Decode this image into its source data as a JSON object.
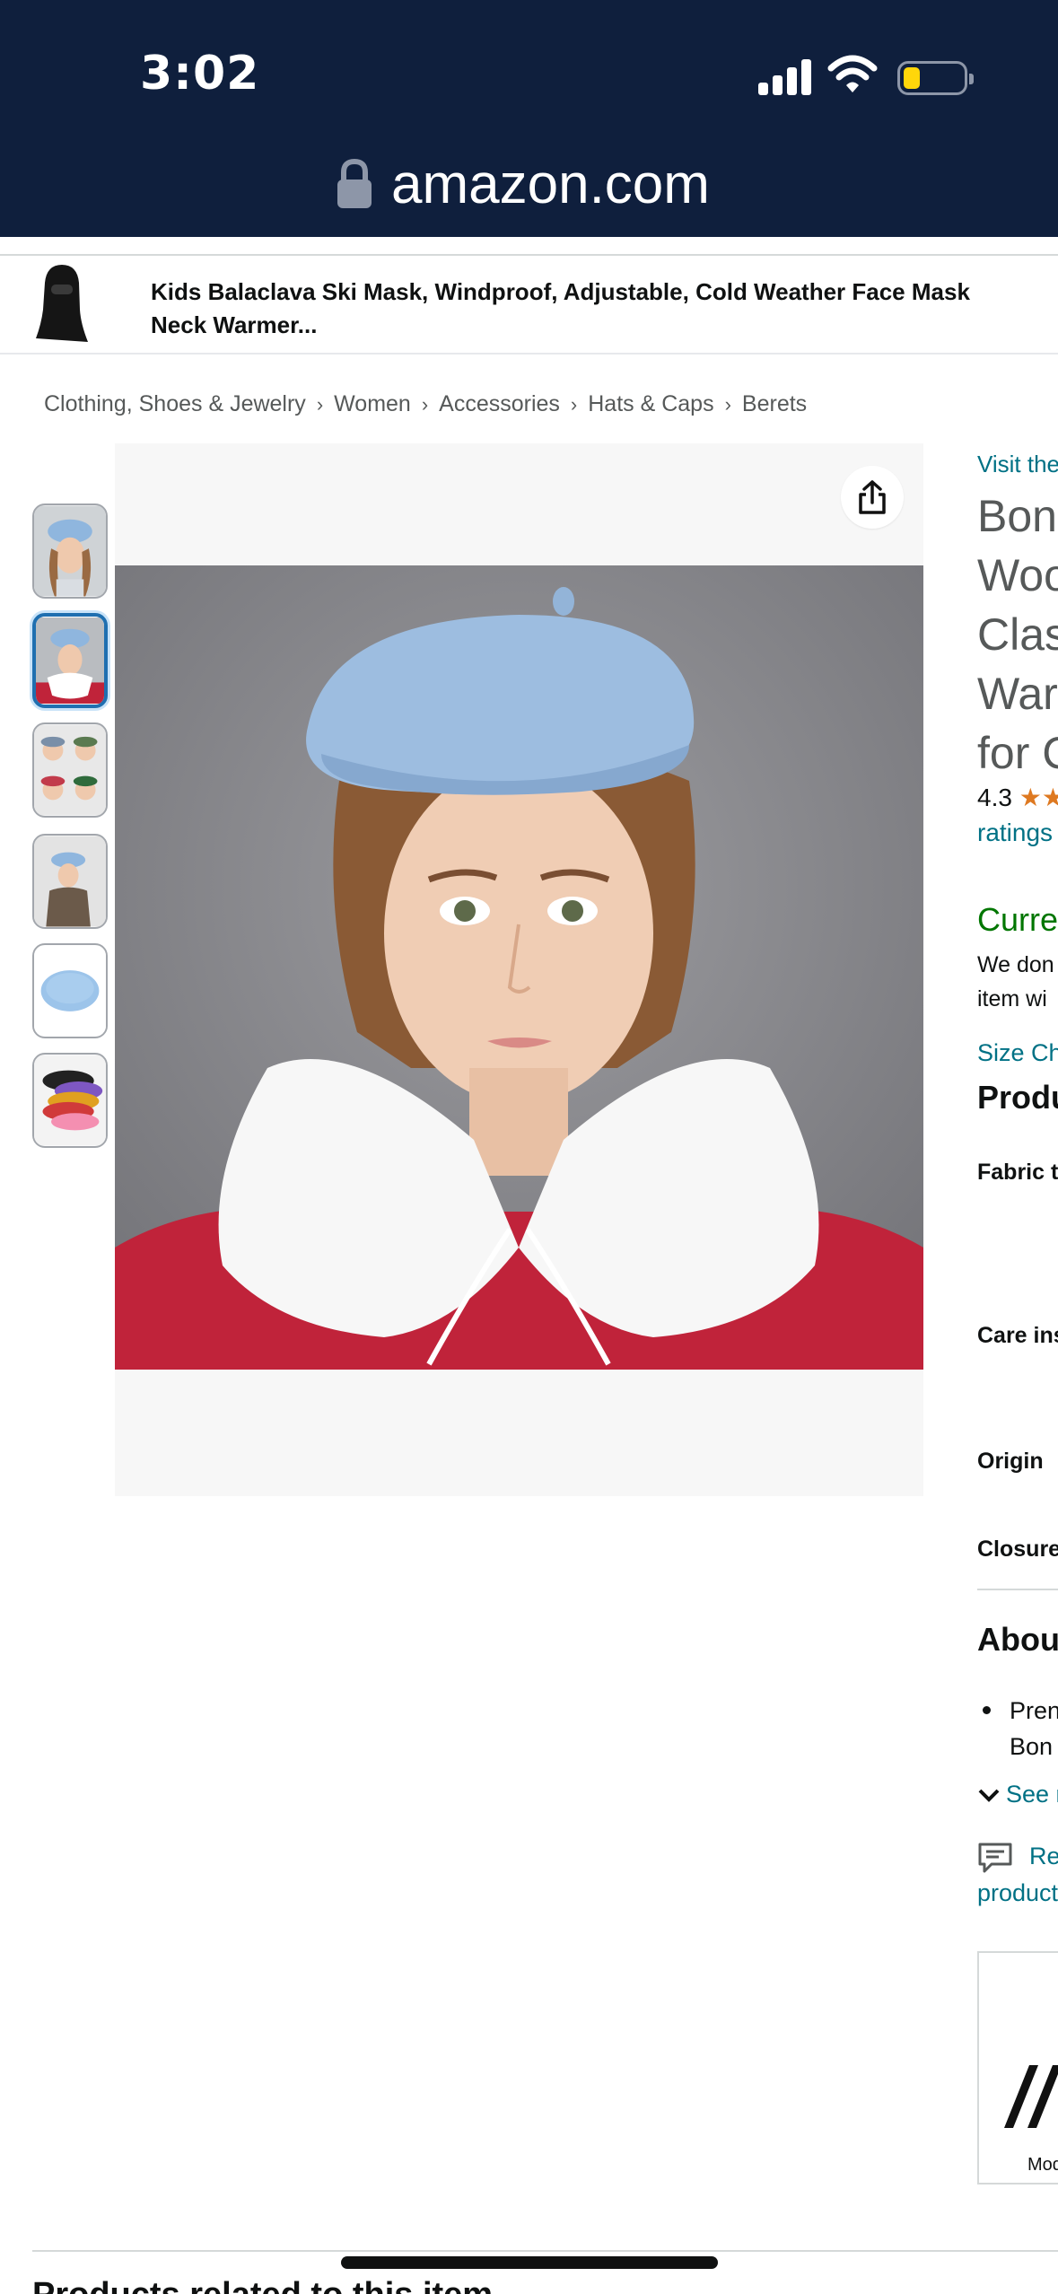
{
  "status_bar": {
    "time": "3:02"
  },
  "browser": {
    "url": "amazon.com"
  },
  "sticky_bar": {
    "product_title": "Kids Balaclava Ski Mask, Windproof, Adjustable, Cold Weather Face Mask Neck Warmer..."
  },
  "breadcrumb": [
    "Clothing, Shoes & Jewelry",
    "Women",
    "Accessories",
    "Hats & Caps",
    "Berets"
  ],
  "gallery": {
    "thumbnails": [
      {
        "label": "girl in blue beret",
        "selected": false
      },
      {
        "label": "girl in blue beret with fur collar",
        "selected": true
      },
      {
        "label": "collage of kids in berets",
        "selected": false
      },
      {
        "label": "girl in beret side view",
        "selected": false
      },
      {
        "label": "blue beret product shot",
        "selected": false
      },
      {
        "label": "assorted beret colors",
        "selected": false
      }
    ]
  },
  "product": {
    "visit_store": "Visit the",
    "title_lines": [
      "Bon",
      "Woo",
      "Clas",
      "War",
      "for C"
    ],
    "rating_value": "4.3",
    "ratings_link": "ratings",
    "availability": "Curre",
    "availability_note_lines": [
      "We don",
      "item wi"
    ],
    "size_chart_link": "Size Ch",
    "details_heading": "Produ",
    "specs": [
      "Fabric t",
      "Care ins",
      "Origin",
      "Closure"
    ],
    "about_heading": "Abou",
    "bullet_lines": [
      "Pren",
      "Bon"
    ],
    "see_more": "See r",
    "report_line1": "Re",
    "report_line2": "product",
    "ad_caption": "Mod"
  },
  "related": {
    "heading": "Products related to this item"
  },
  "colors": {
    "header_bg": "#0f1f3d",
    "link": "#007185",
    "availability_green": "#007600",
    "star": "#de7921",
    "selected_thumb_border": "#1f6fb0",
    "battery": "#ffd60a"
  }
}
